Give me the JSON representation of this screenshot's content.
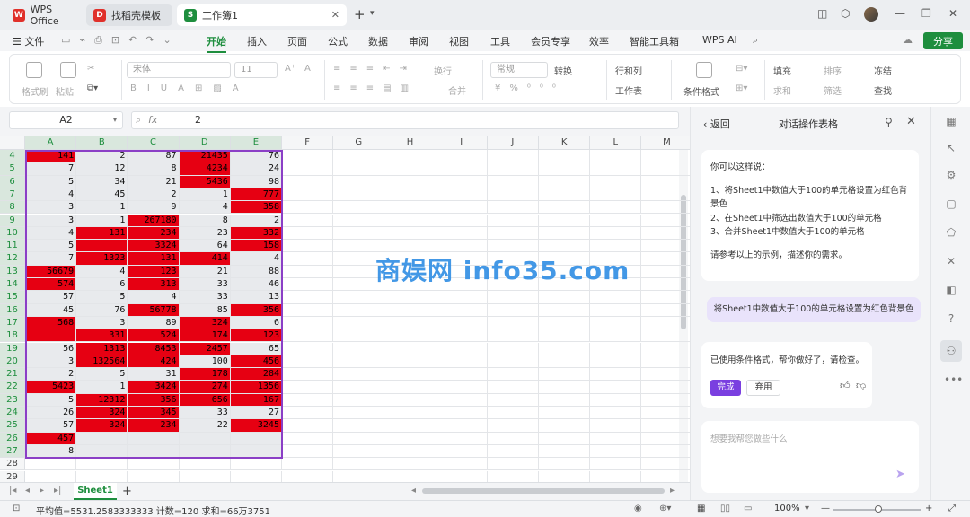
{
  "titlebar": {
    "tabs": [
      {
        "label": "WPS Office",
        "icon": "wps-logo-icon"
      },
      {
        "label": "找稻壳模板",
        "icon": "docer-icon"
      },
      {
        "label": "工作簿1",
        "icon": "sheet-icon"
      }
    ]
  },
  "menubar": {
    "file_label": "文件",
    "items": [
      "开始",
      "插入",
      "页面",
      "公式",
      "数据",
      "审阅",
      "视图",
      "工具",
      "会员专享",
      "效率",
      "智能工具箱",
      "WPS AI"
    ],
    "share_label": "分享"
  },
  "ribbon": {
    "format_painter": "格式刷",
    "paste": "粘贴",
    "font_name": "宋体",
    "font_size": "11",
    "wrap": "换行",
    "number_format": "常规",
    "convert": "转换",
    "merge": "合并",
    "row_col": "行和列",
    "worksheet": "工作表",
    "cond_format": "条件格式",
    "fill": "填充",
    "sort": "排序",
    "freeze": "冻结",
    "sum": "求和",
    "filter": "筛选",
    "find": "查找"
  },
  "formula_bar": {
    "namebox": "A2",
    "fx": "fx",
    "value": "2"
  },
  "grid": {
    "columns": [
      "A",
      "B",
      "C",
      "D",
      "E",
      "F",
      "G",
      "H",
      "I",
      "J",
      "K",
      "L",
      "M"
    ],
    "rows": [
      {
        "n": "4",
        "cells": [
          [
            "141",
            true
          ],
          [
            "2",
            false
          ],
          [
            "87",
            false
          ],
          [
            "21435",
            true
          ],
          [
            "76",
            false
          ]
        ]
      },
      {
        "n": "5",
        "cells": [
          [
            "7",
            false
          ],
          [
            "12",
            false
          ],
          [
            "8",
            false
          ],
          [
            "4234",
            true
          ],
          [
            "24",
            false
          ]
        ]
      },
      {
        "n": "6",
        "cells": [
          [
            "5",
            false
          ],
          [
            "34",
            false
          ],
          [
            "21",
            false
          ],
          [
            "5436",
            true
          ],
          [
            "98",
            false
          ]
        ]
      },
      {
        "n": "7",
        "cells": [
          [
            "4",
            false
          ],
          [
            "45",
            false
          ],
          [
            "2",
            false
          ],
          [
            "1",
            false
          ],
          [
            "777",
            true
          ]
        ]
      },
      {
        "n": "8",
        "cells": [
          [
            "3",
            false
          ],
          [
            "1",
            false
          ],
          [
            "9",
            false
          ],
          [
            "4",
            false
          ],
          [
            "358",
            true
          ]
        ]
      },
      {
        "n": "9",
        "cells": [
          [
            "3",
            false
          ],
          [
            "1",
            false
          ],
          [
            "267180",
            true
          ],
          [
            "8",
            false
          ],
          [
            "2",
            false
          ]
        ]
      },
      {
        "n": "10",
        "cells": [
          [
            "4",
            false
          ],
          [
            "131",
            true
          ],
          [
            "234",
            true
          ],
          [
            "23",
            false
          ],
          [
            "332",
            true
          ]
        ]
      },
      {
        "n": "11",
        "cells": [
          [
            "5",
            false
          ],
          [
            "",
            true
          ],
          [
            "3324",
            true
          ],
          [
            "64",
            false
          ],
          [
            "158",
            true
          ]
        ]
      },
      {
        "n": "12",
        "cells": [
          [
            "7",
            false
          ],
          [
            "1323",
            true
          ],
          [
            "131",
            true
          ],
          [
            "414",
            true
          ],
          [
            "4",
            false
          ]
        ]
      },
      {
        "n": "13",
        "cells": [
          [
            "56679",
            true
          ],
          [
            "4",
            false
          ],
          [
            "123",
            true
          ],
          [
            "21",
            false
          ],
          [
            "88",
            false
          ]
        ]
      },
      {
        "n": "14",
        "cells": [
          [
            "574",
            true
          ],
          [
            "6",
            false
          ],
          [
            "313",
            true
          ],
          [
            "33",
            false
          ],
          [
            "46",
            false
          ]
        ]
      },
      {
        "n": "15",
        "cells": [
          [
            "57",
            false
          ],
          [
            "5",
            false
          ],
          [
            "4",
            false
          ],
          [
            "33",
            false
          ],
          [
            "13",
            false
          ]
        ]
      },
      {
        "n": "16",
        "cells": [
          [
            "45",
            false
          ],
          [
            "76",
            false
          ],
          [
            "56778",
            true
          ],
          [
            "85",
            false
          ],
          [
            "356",
            true
          ]
        ]
      },
      {
        "n": "17",
        "cells": [
          [
            "568",
            true
          ],
          [
            "3",
            false
          ],
          [
            "89",
            false
          ],
          [
            "324",
            true
          ],
          [
            "6",
            false
          ]
        ]
      },
      {
        "n": "18",
        "cells": [
          [
            "",
            true
          ],
          [
            "331",
            true
          ],
          [
            "524",
            true
          ],
          [
            "174",
            true
          ],
          [
            "123",
            true
          ]
        ]
      },
      {
        "n": "19",
        "cells": [
          [
            "56",
            false
          ],
          [
            "1313",
            true
          ],
          [
            "8453",
            true
          ],
          [
            "2457",
            true
          ],
          [
            "65",
            false
          ]
        ]
      },
      {
        "n": "20",
        "cells": [
          [
            "3",
            false
          ],
          [
            "132564",
            true
          ],
          [
            "424",
            true
          ],
          [
            "100",
            false
          ],
          [
            "456",
            true
          ]
        ]
      },
      {
        "n": "21",
        "cells": [
          [
            "2",
            false
          ],
          [
            "5",
            false
          ],
          [
            "31",
            false
          ],
          [
            "178",
            true
          ],
          [
            "284",
            true
          ]
        ]
      },
      {
        "n": "22",
        "cells": [
          [
            "5423",
            true
          ],
          [
            "1",
            false
          ],
          [
            "3424",
            true
          ],
          [
            "274",
            true
          ],
          [
            "1356",
            true
          ]
        ]
      },
      {
        "n": "23",
        "cells": [
          [
            "5",
            false
          ],
          [
            "12312",
            true
          ],
          [
            "356",
            true
          ],
          [
            "656",
            true
          ],
          [
            "167",
            true
          ]
        ]
      },
      {
        "n": "24",
        "cells": [
          [
            "26",
            false
          ],
          [
            "324",
            true
          ],
          [
            "345",
            true
          ],
          [
            "33",
            false
          ],
          [
            "27",
            false
          ]
        ]
      },
      {
        "n": "25",
        "cells": [
          [
            "57",
            false
          ],
          [
            "324",
            true
          ],
          [
            "234",
            true
          ],
          [
            "22",
            false
          ],
          [
            "3245",
            true
          ]
        ]
      },
      {
        "n": "26",
        "cells": [
          [
            "457",
            true
          ],
          [
            "",
            false
          ],
          [
            "",
            false
          ],
          [
            "",
            false
          ],
          [
            "",
            false
          ]
        ]
      },
      {
        "n": "27",
        "cells": [
          [
            "8",
            false
          ],
          [
            "",
            false
          ],
          [
            "",
            false
          ],
          [
            "",
            false
          ],
          [
            "",
            false
          ]
        ]
      },
      {
        "n": "28",
        "cells": [
          [
            "",
            false
          ],
          [
            "",
            false
          ],
          [
            "",
            false
          ],
          [
            "",
            false
          ],
          [
            "",
            false
          ]
        ]
      },
      {
        "n": "29",
        "cells": [
          [
            "",
            false
          ],
          [
            "",
            false
          ],
          [
            "",
            false
          ],
          [
            "",
            false
          ],
          [
            "",
            false
          ]
        ]
      }
    ],
    "highlight_color": "#e60012",
    "selection_color": "#8b3fc6"
  },
  "sheets": {
    "active": "Sheet1"
  },
  "status": {
    "summary": "平均值=5531.2583333333  计数=120  求和=66万3751",
    "zoom": "100%"
  },
  "panel": {
    "back": "返回",
    "title": "对话操作表格",
    "intro": "你可以这样说：",
    "examples": [
      "1、将Sheet1中数值大于100的单元格设置为红色背景色",
      "2、在Sheet1中筛选出数值大于100的单元格",
      "3、合并Sheet1中数值大于100的单元格"
    ],
    "hint": "请参考以上的示例，描述你的需求。",
    "user_message": "将Sheet1中数值大于100的单元格设置为红色背景色",
    "reply": "已使用条件格式，帮你做好了，请检查。",
    "done_label": "完成",
    "discard_label": "弃用",
    "input_placeholder": "想要我帮您做些什么"
  },
  "watermark": "商娱网 info35.com"
}
